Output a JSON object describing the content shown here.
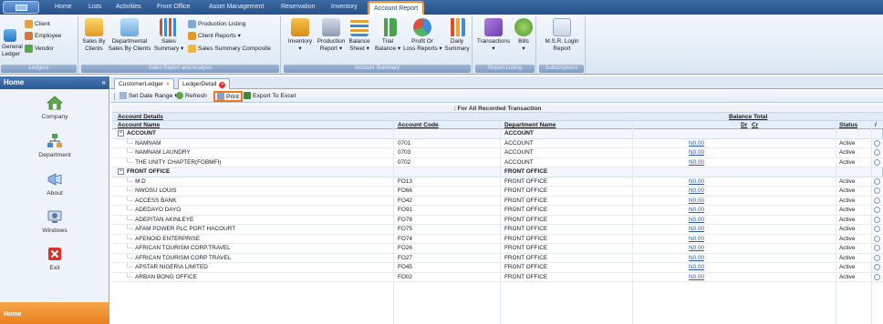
{
  "ribbon_tabs": [
    "Home",
    "Lists",
    "Activities",
    "Front Office",
    "Asset Management",
    "Reservation",
    "Inventory",
    "Account Report"
  ],
  "active_tab": "Account Report",
  "ribbon": {
    "ledgers": {
      "label": "Ledgers",
      "general": "General\nLedger",
      "client": "Client",
      "employee": "Employee",
      "vendor": "Vendor"
    },
    "sales": {
      "label": "Sales Report and Analysis",
      "sales_by_clients": "Sales By\nClients",
      "departmental": "Departmental\nSales By Clients",
      "sales_summary": "Sales\nSummary ▾",
      "production_listing": "Production Listing",
      "client_reports": "Client Reports ▾",
      "sales_summary_composite": "Sales Summary Composite"
    },
    "account_summary": {
      "label": "Account Summary",
      "inventory_report": "Inventory\n▾",
      "production_report": "Production\nReport ▾",
      "balance_sheet": "Balance\nSheet ▾",
      "trial_balance": "Trial\nBalance ▾",
      "profit_or_loss": "Profit Or\nLoss Reports ▾",
      "daily_summary": "Daily\nSummary"
    },
    "report_listing": {
      "label": "Report Listing",
      "transactions": "Transactions\n▾",
      "bills": "Bills\n▾"
    },
    "subscriptions": {
      "label": "Subscriptions",
      "msr_login": "M.S.R. Login\nReport"
    }
  },
  "sidebar": {
    "title": "Home",
    "collapse": "«",
    "items": [
      {
        "label": "Company",
        "icon": "house-icon"
      },
      {
        "label": "Department",
        "icon": "org-chart-icon"
      },
      {
        "label": "About",
        "icon": "megaphone-icon"
      },
      {
        "label": "Windows",
        "icon": "windows-icon"
      },
      {
        "label": "Exit",
        "icon": "exit-icon"
      }
    ],
    "footer": "Home",
    "grip": "......."
  },
  "doc_tabs": [
    {
      "label": "CustomerLedger",
      "close": "×"
    },
    {
      "label": "LedgerDetail",
      "close": "×"
    }
  ],
  "toolbar": {
    "set_date_range": "Set Date Range ▾",
    "refresh": "Refresh",
    "print": "Print",
    "export": "Export To Excel"
  },
  "grid": {
    "banner": ": For All Recorded Transaction",
    "group_headers": {
      "account_details": "Account Details",
      "balance_total": "Balance Total"
    },
    "columns": {
      "account_name": "Account Name",
      "account_code": "Account Code",
      "department_name": "Department Name",
      "dr": "Dr",
      "cr": "Cr",
      "status": "Status",
      "extra": "/"
    },
    "rows": [
      {
        "type": "group",
        "name": "ACCOUNT",
        "dept": "ACCOUNT"
      },
      {
        "type": "item",
        "name": "NAMNAM",
        "code": "0701",
        "dept": "ACCOUNT",
        "balance": "N0.00",
        "status": "Active"
      },
      {
        "type": "item",
        "name": "NAMNAM LAUNDRY",
        "code": "0703",
        "dept": "ACCOUNT",
        "balance": "N0.00",
        "status": "Active"
      },
      {
        "type": "item",
        "name": "THE UNITY CHAPTER(FGBMFI)",
        "code": "0702",
        "dept": "ACCOUNT",
        "balance": "N0.00",
        "status": "Active"
      },
      {
        "type": "group",
        "name": "FRONT OFFICE",
        "dept": "FRONT OFFICE"
      },
      {
        "type": "item",
        "name": "M.D",
        "code": "FO13",
        "dept": "FRONT OFFICE",
        "balance": "N0.00",
        "status": "Active"
      },
      {
        "type": "item",
        "name": "NWOSU LOUIS",
        "code": "FO66",
        "dept": "FRONT OFFICE",
        "balance": "N0.00",
        "status": "Active"
      },
      {
        "type": "item",
        "name": "ACCESS BANK",
        "code": "FO42",
        "dept": "FRONT OFFICE",
        "balance": "N0.00",
        "status": "Active"
      },
      {
        "type": "item",
        "name": "ADEDAYO DAYO",
        "code": "FO91",
        "dept": "FRONT OFFICE",
        "balance": "N0.00",
        "status": "Active"
      },
      {
        "type": "item",
        "name": "ADEPITAN AKINLEYE",
        "code": "FO78",
        "dept": "FRONT OFFICE",
        "balance": "N0.00",
        "status": "Active"
      },
      {
        "type": "item",
        "name": "AFAM POWER PLC PORT HACOURT",
        "code": "FO75",
        "dept": "FRONT OFFICE",
        "balance": "N0.00",
        "status": "Active"
      },
      {
        "type": "item",
        "name": "AFENOID ENTERPRISE",
        "code": "FO74",
        "dept": "FRONT OFFICE",
        "balance": "N0.00",
        "status": "Active"
      },
      {
        "type": "item",
        "name": "AFRICAN TOURISM CORP.TRAVEL",
        "code": "FO26",
        "dept": "FRONT OFFICE",
        "balance": "N0.00",
        "status": "Active"
      },
      {
        "type": "item",
        "name": "AFRICAN TOURISM CORP TRAVEL",
        "code": "FO27",
        "dept": "FRONT OFFICE",
        "balance": "N0.00",
        "status": "Active"
      },
      {
        "type": "item",
        "name": "APSTAR NIGERIA LIMITED",
        "code": "FO45",
        "dept": "FRONT OFFICE",
        "balance": "N0.00",
        "status": "Active"
      },
      {
        "type": "item",
        "name": "ARBAN BONG OFFICE",
        "code": "FO02",
        "dept": "FRONT OFFICE",
        "balance": "N0.00",
        "status": "Active"
      }
    ]
  },
  "colors": {
    "accent": "#f07a1a",
    "ribbon_dark": "#27518a",
    "link": "#2b58b5"
  }
}
